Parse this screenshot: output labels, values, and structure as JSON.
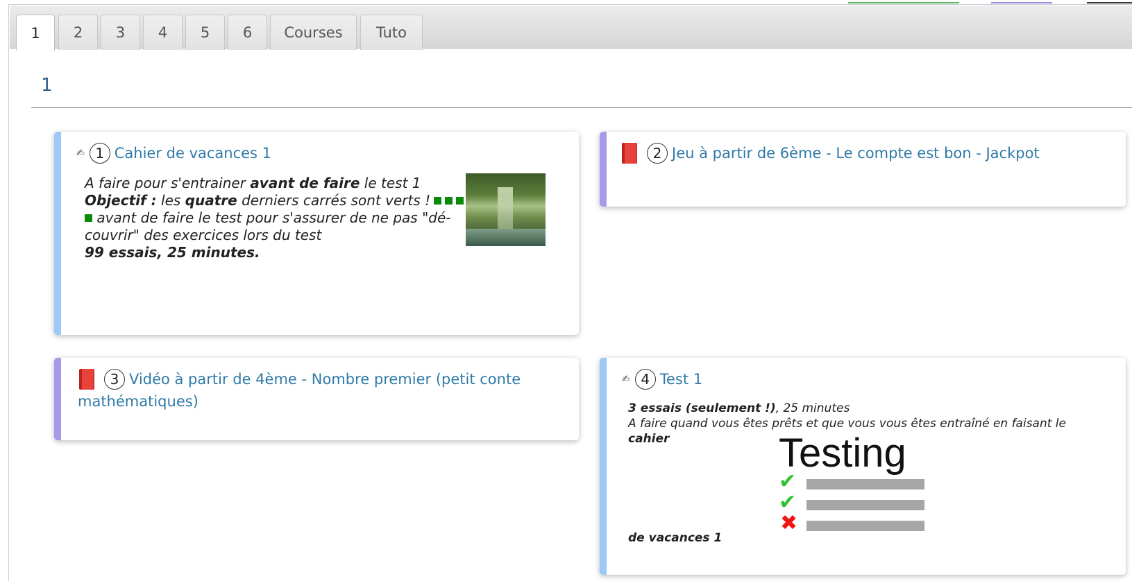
{
  "tabs": [
    {
      "label": "1",
      "active": true
    },
    {
      "label": "2"
    },
    {
      "label": "3"
    },
    {
      "label": "4"
    },
    {
      "label": "5"
    },
    {
      "label": "6"
    },
    {
      "label": "Courses"
    },
    {
      "label": "Tuto"
    }
  ],
  "section": {
    "title": "1"
  },
  "cards": [
    {
      "number": "1",
      "icon": "pencil-icon",
      "title": "Cahier de vacances 1",
      "desc": {
        "l1a": "A faire pour s'entrainer ",
        "l1b": "avant de faire",
        "l1c": " le test 1",
        "l2a": "Objectif :",
        "l2b": " les ",
        "l2c": "quatre",
        "l2d": " derniers carrés sont verts !",
        "l3": " avant de faire le test pour s'assurer de ne pas \"dé-",
        "l4": "couvrir\" des exercices lors du test",
        "l5": "99 essais, 25 minutes."
      },
      "square_color": "#0a8a0a"
    },
    {
      "number": "2",
      "icon": "book-icon",
      "title": "Jeu à partir de 6ème - Le compte est bon - Jackpot"
    },
    {
      "number": "3",
      "icon": "book-icon",
      "title_l1": "Vidéo à partir de 4ème - Nombre premier (petit conte",
      "title_l2": "mathématiques)"
    },
    {
      "number": "4",
      "icon": "pencil-icon",
      "title": "Test 1",
      "desc": {
        "l1a": "3 essais (seulement !)",
        "l1b": ", 25 minutes",
        "l2a": "A faire quand vous êtes prêts et que vous vous êtes entraîné en faisant le ",
        "l2b": "cahier",
        "l3": "de vacances 1"
      },
      "image_word": "Testing"
    }
  ],
  "colors": {
    "card_blue": "#9ec8f5",
    "card_purple": "#a89ae9",
    "link": "#2f7aa8"
  }
}
